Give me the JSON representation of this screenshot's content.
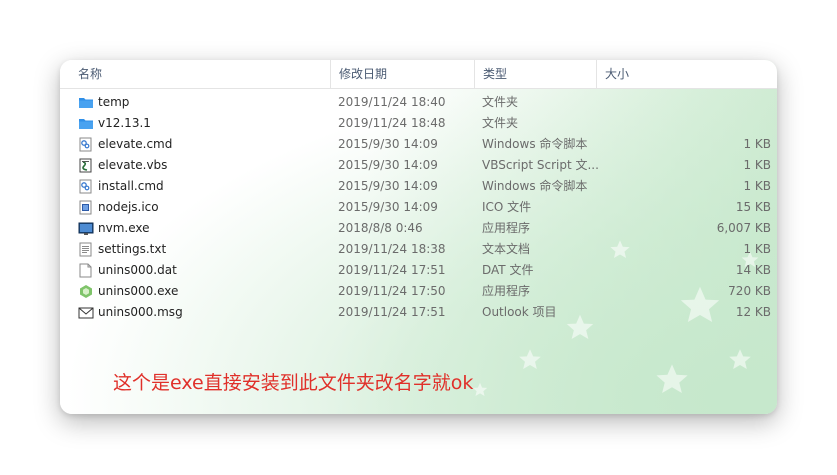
{
  "columns": {
    "name": "名称",
    "modified": "修改日期",
    "type": "类型",
    "size": "大小"
  },
  "files": [
    {
      "name": "temp",
      "modified": "2019/11/24 18:40",
      "type": "文件夹",
      "size": "",
      "icon": "folder-icon"
    },
    {
      "name": "v12.13.1",
      "modified": "2019/11/24 18:48",
      "type": "文件夹",
      "size": "",
      "icon": "folder-icon"
    },
    {
      "name": "elevate.cmd",
      "modified": "2015/9/30 14:09",
      "type": "Windows 命令脚本",
      "size": "1 KB",
      "icon": "cmd-script-icon"
    },
    {
      "name": "elevate.vbs",
      "modified": "2015/9/30 14:09",
      "type": "VBScript Script 文...",
      "size": "1 KB",
      "icon": "vbscript-icon"
    },
    {
      "name": "install.cmd",
      "modified": "2015/9/30 14:09",
      "type": "Windows 命令脚本",
      "size": "1 KB",
      "icon": "cmd-script-icon"
    },
    {
      "name": "nodejs.ico",
      "modified": "2015/9/30 14:09",
      "type": "ICO 文件",
      "size": "15 KB",
      "icon": "image-file-icon"
    },
    {
      "name": "nvm.exe",
      "modified": "2018/8/8 0:46",
      "type": "应用程序",
      "size": "6,007 KB",
      "icon": "application-icon"
    },
    {
      "name": "settings.txt",
      "modified": "2019/11/24 18:38",
      "type": "文本文档",
      "size": "1 KB",
      "icon": "text-file-icon"
    },
    {
      "name": "unins000.dat",
      "modified": "2019/11/24 17:51",
      "type": "DAT 文件",
      "size": "14 KB",
      "icon": "blank-file-icon"
    },
    {
      "name": "unins000.exe",
      "modified": "2019/11/24 17:50",
      "type": "应用程序",
      "size": "720 KB",
      "icon": "installer-icon"
    },
    {
      "name": "unins000.msg",
      "modified": "2019/11/24 17:51",
      "type": "Outlook 项目",
      "size": "12 KB",
      "icon": "mail-icon"
    }
  ],
  "annotation": "这个是exe直接安装到此文件夹改名字就ok",
  "colors": {
    "annotation": "#e0302a",
    "folder": "#2f8fe8",
    "header_text": "#4a5a72"
  }
}
